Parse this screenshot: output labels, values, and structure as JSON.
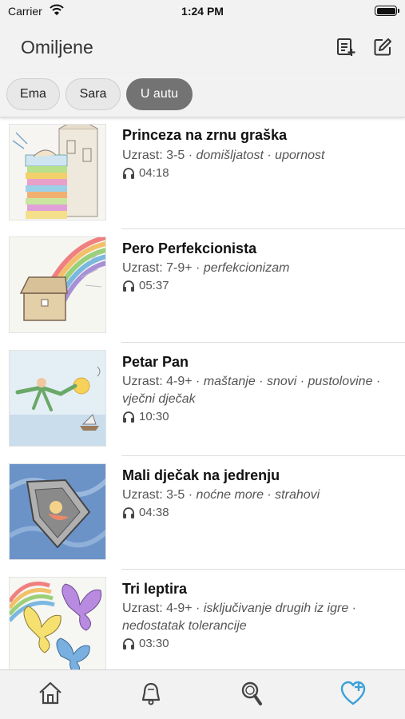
{
  "status_bar": {
    "carrier": "Carrier",
    "time": "1:24 PM"
  },
  "header": {
    "title": "Omiljene",
    "list_icon": "playlist-add-icon",
    "edit_icon": "edit-icon"
  },
  "chips": [
    {
      "label": "Ema",
      "selected": false
    },
    {
      "label": "Sara",
      "selected": false
    },
    {
      "label": "U autu",
      "selected": true
    }
  ],
  "stories": [
    {
      "title": "Princeza na zrnu graška",
      "age": "Uzrast: 3-5",
      "tags": "domišljatost · upornost",
      "duration": "04:18"
    },
    {
      "title": "Pero Perfekcionista",
      "age": "Uzrast: 7-9+",
      "tags": "perfekcionizam",
      "duration": "05:37"
    },
    {
      "title": "Petar Pan",
      "age": "Uzrast: 4-9+",
      "tags": "maštanje · snovi · pustolovine · vječni dječak",
      "duration": "10:30"
    },
    {
      "title": "Mali dječak na jedrenju",
      "age": "Uzrast: 3-5",
      "tags": "noćne more · strahovi",
      "duration": "04:38"
    },
    {
      "title": "Tri leptira",
      "age": "Uzrast: 4-9+",
      "tags": "isključivanje drugih iz igre · nedostatak tolerancije",
      "duration": "03:30"
    }
  ],
  "tab_bar": [
    {
      "icon": "home-icon",
      "active": false
    },
    {
      "icon": "bell-icon",
      "active": false
    },
    {
      "icon": "search-icon",
      "active": false
    },
    {
      "icon": "heart-icon",
      "active": true
    }
  ],
  "colors": {
    "accent": "#3aa0d8",
    "selected_chip": "#737373",
    "bar_background": "#f2f2f2"
  }
}
